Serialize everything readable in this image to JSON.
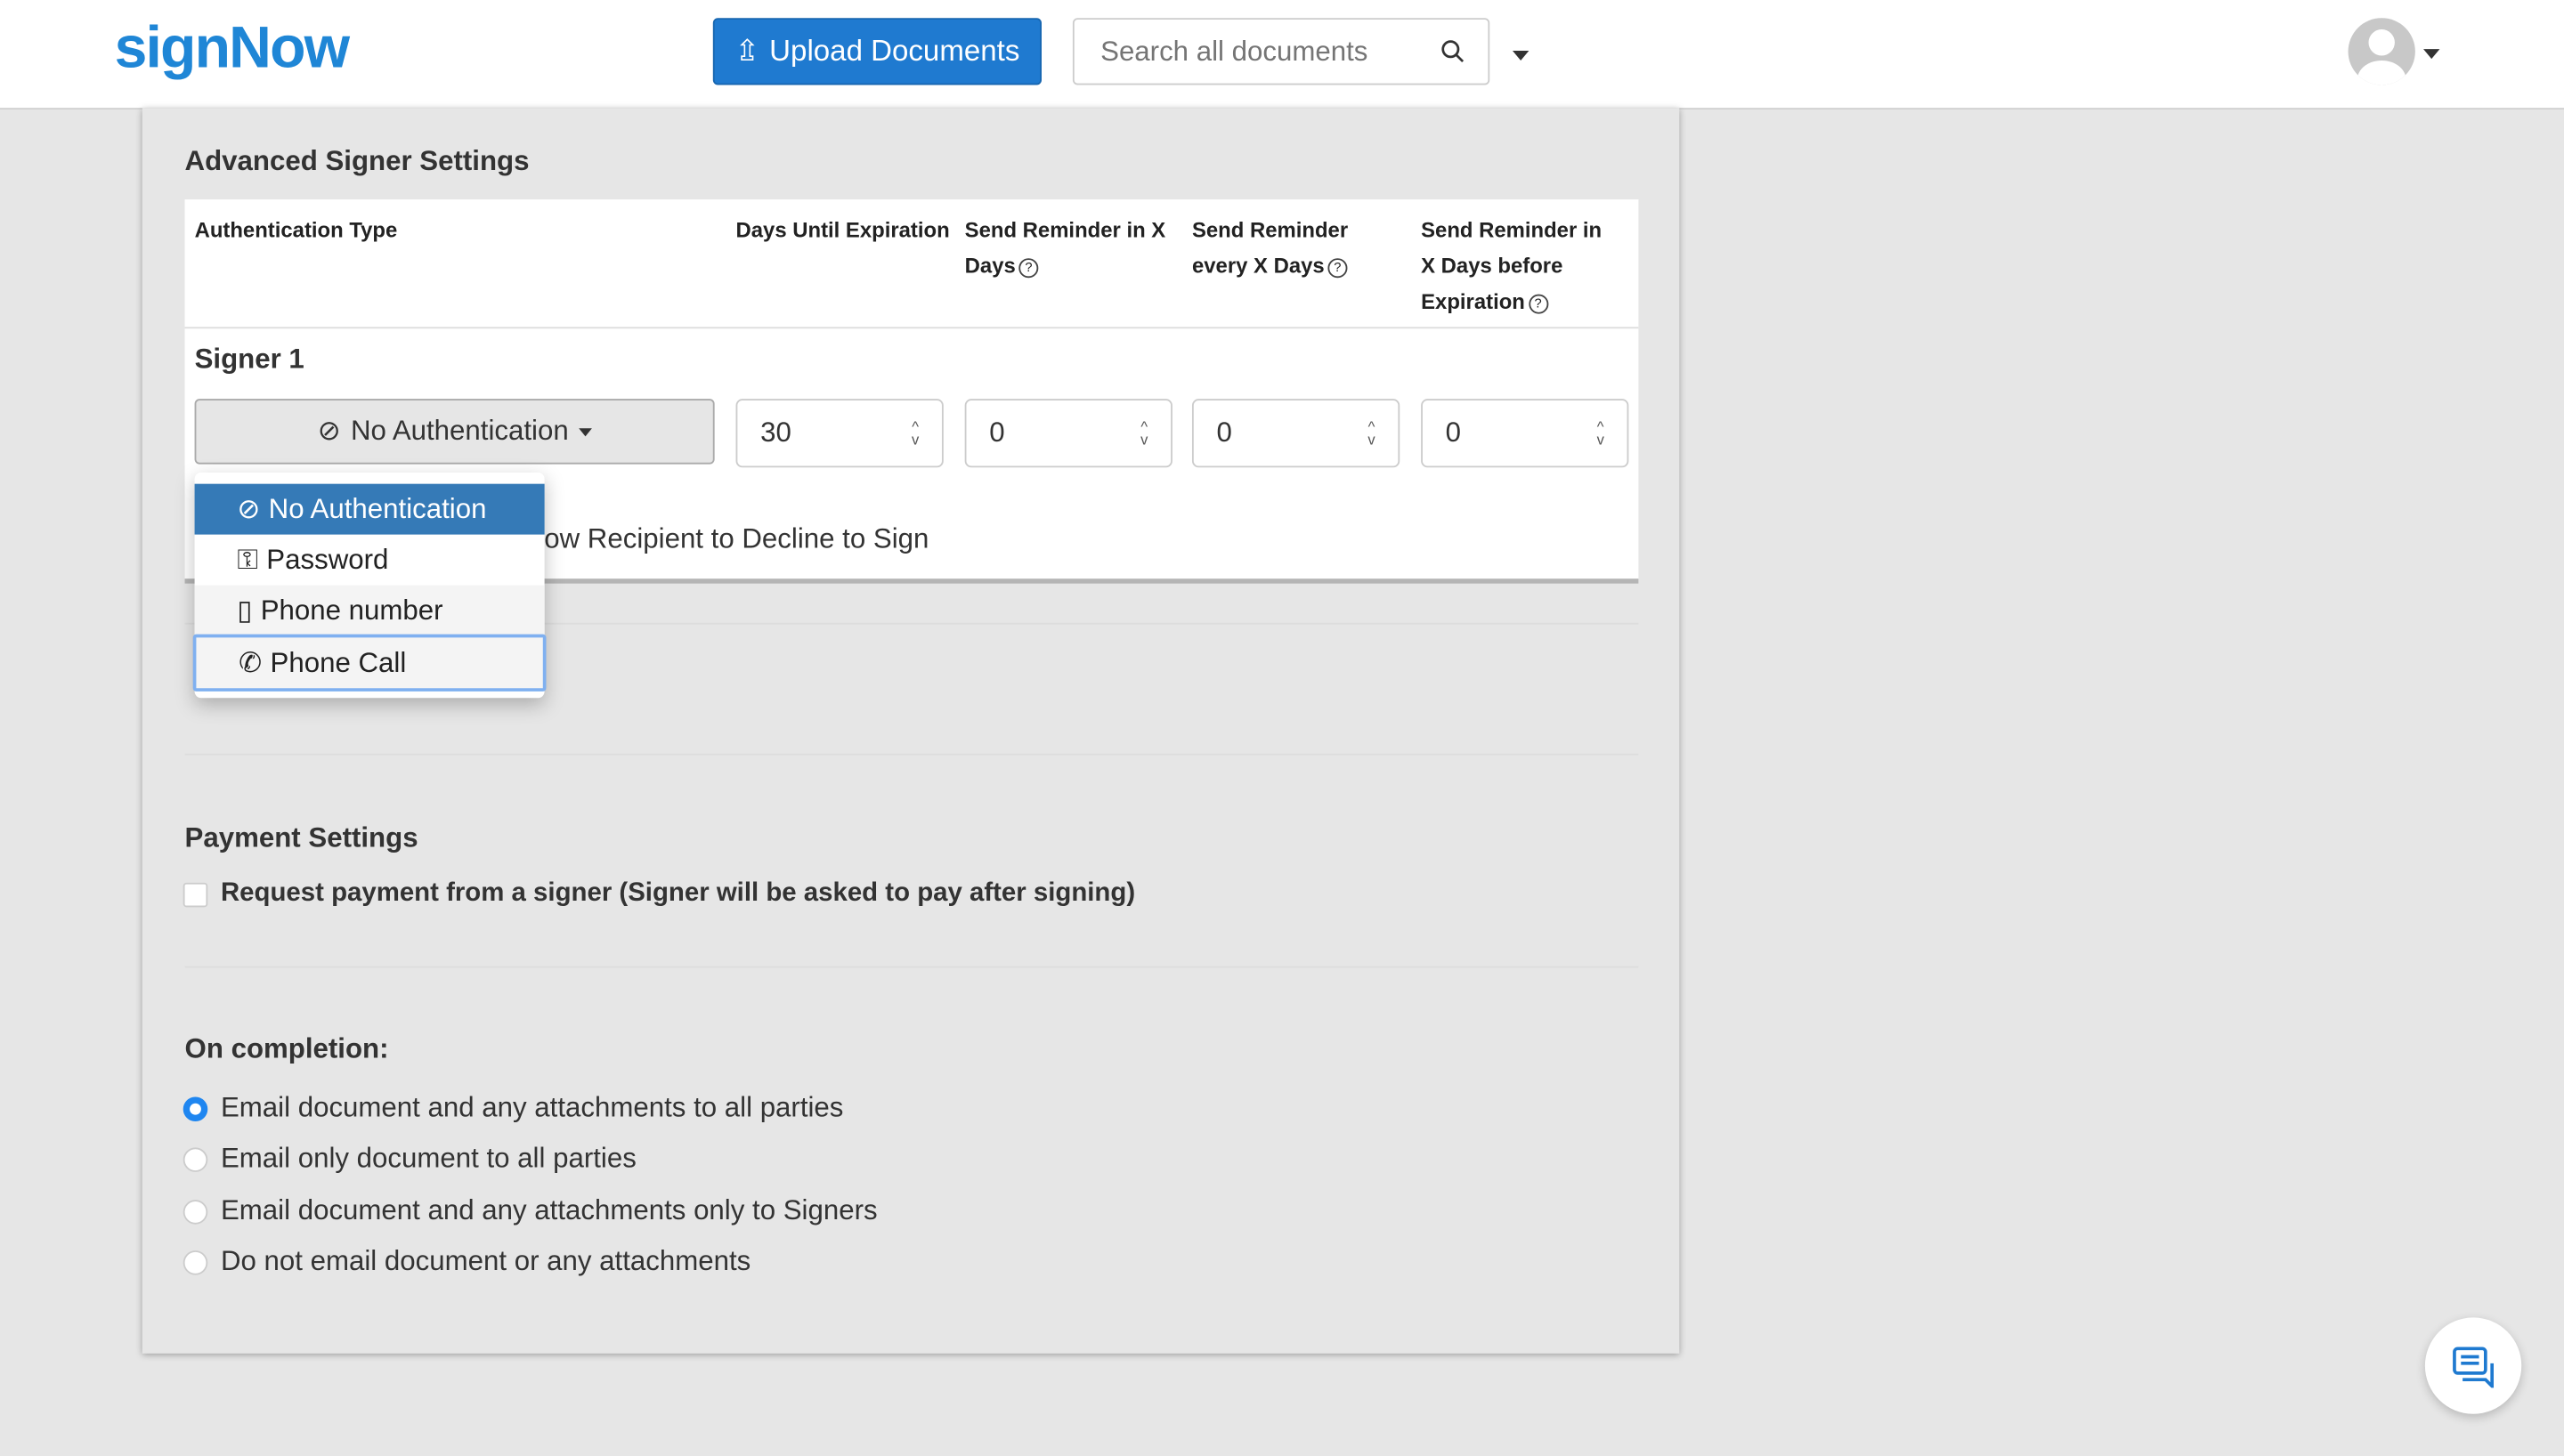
{
  "header": {
    "logo": "signNow",
    "upload_label": "Upload Documents",
    "search_placeholder": "Search all documents",
    "accent": "#1f7ad0"
  },
  "advanced": {
    "title": "Advanced Signer Settings",
    "columns": [
      "Authentication Type",
      "Days Until Expiration",
      "Send Reminder in X Days",
      "Send Reminder every X Days",
      "Send Reminder in X Days before Expiration"
    ],
    "signer_label": "Signer 1",
    "auth_value": "No Authentication",
    "days_until_expiration": "30",
    "reminder_in": "0",
    "reminder_every": "0",
    "reminder_before_expiration": "0",
    "decline_label": "Allow Recipient to Decline to Sign",
    "decline_visible": "low Recipient to Decline to Sign",
    "auth_options": [
      {
        "label": "No Authentication",
        "icon": "ban-icon"
      },
      {
        "label": "Password",
        "icon": "key-icon"
      },
      {
        "label": "Phone number",
        "icon": "mobile-icon"
      },
      {
        "label": "Phone Call",
        "icon": "phone-icon"
      }
    ]
  },
  "payment": {
    "title": "Payment Settings",
    "checkbox_label": "Request payment from a signer (Signer will be asked to pay after signing)",
    "checked": false
  },
  "completion": {
    "title": "On completion:",
    "options": [
      "Email document and any attachments to all parties",
      "Email only document to all parties",
      "Email document and any attachments only to Signers",
      "Do not email document or any attachments"
    ],
    "selected": 0
  }
}
